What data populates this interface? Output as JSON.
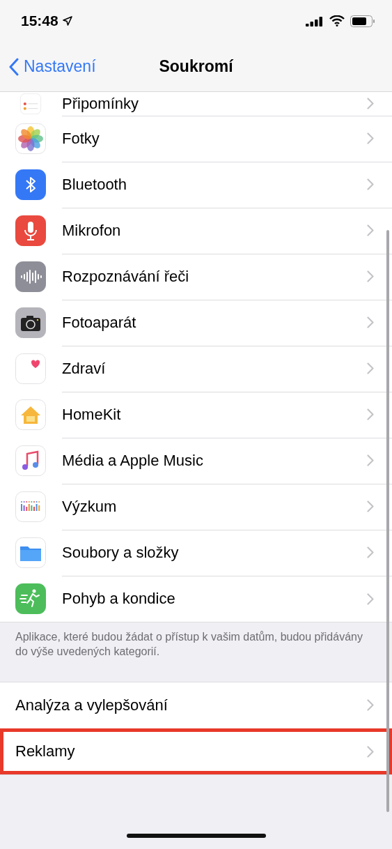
{
  "status_bar": {
    "time": "15:48"
  },
  "nav": {
    "back": "Nastavení",
    "title": "Soukromí"
  },
  "privacy_items": [
    {
      "kind": "reminders",
      "label": "Připomínky"
    },
    {
      "kind": "photos",
      "label": "Fotky"
    },
    {
      "kind": "bluetooth",
      "label": "Bluetooth"
    },
    {
      "kind": "microphone",
      "label": "Mikrofon"
    },
    {
      "kind": "speech",
      "label": "Rozpoznávání řeči"
    },
    {
      "kind": "camera",
      "label": "Fotoaparát"
    },
    {
      "kind": "health",
      "label": "Zdraví"
    },
    {
      "kind": "homekit",
      "label": "HomeKit"
    },
    {
      "kind": "music",
      "label": "Média a Apple Music"
    },
    {
      "kind": "research",
      "label": "Výzkum"
    },
    {
      "kind": "files",
      "label": "Soubory a složky"
    },
    {
      "kind": "fitness",
      "label": "Pohyb a kondice"
    }
  ],
  "footer": "Aplikace, které budou žádat o přístup k vašim datům, budou přidávány do výše uvedených kategorií.",
  "other_items": [
    {
      "label": "Analýza a vylepšování",
      "highlighted": false
    },
    {
      "label": "Reklamy",
      "highlighted": true
    }
  ]
}
